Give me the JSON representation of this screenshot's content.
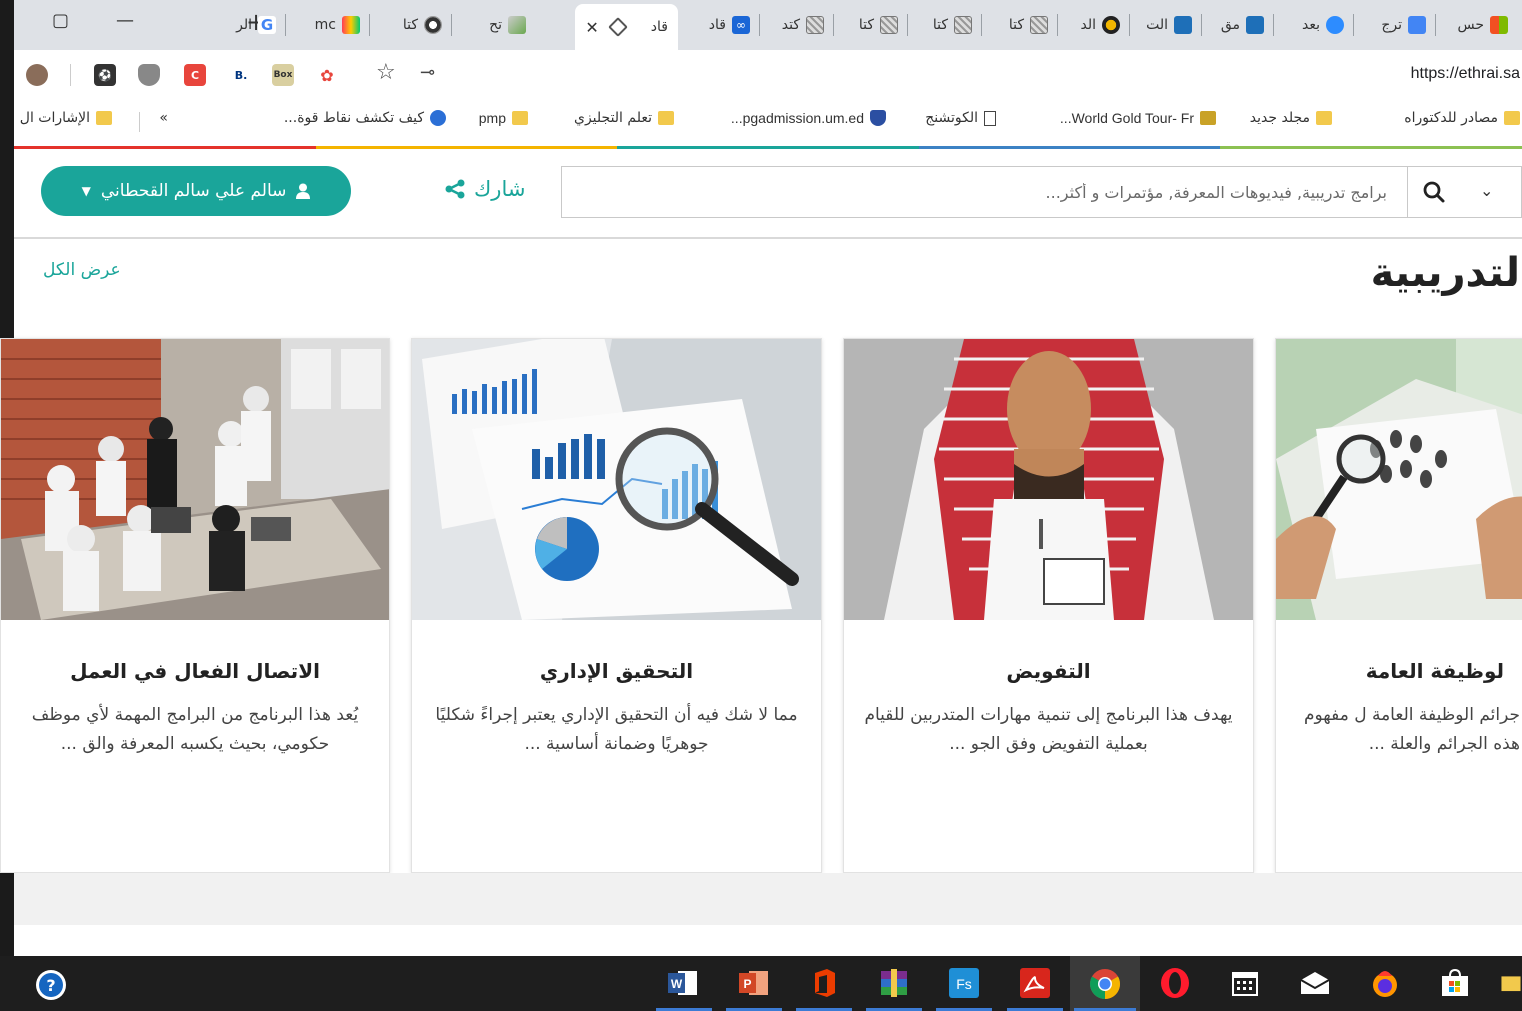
{
  "browser": {
    "tabs": [
      {
        "label": "حس",
        "icon": "microsoft-icon"
      },
      {
        "label": "ترج",
        "icon": "google-translate-icon"
      },
      {
        "label": "بعد",
        "icon": "zoom-icon"
      },
      {
        "label": "مق",
        "icon": "doc-icon"
      },
      {
        "label": "الت",
        "icon": "doc-icon"
      },
      {
        "label": "الد",
        "icon": "circle-icon"
      },
      {
        "label": "كتا",
        "icon": "qr-icon"
      },
      {
        "label": "كتا",
        "icon": "qr-icon"
      },
      {
        "label": "كتا",
        "icon": "qr-icon"
      },
      {
        "label": "كتد",
        "icon": "qr-icon"
      },
      {
        "label": "قاد",
        "icon": "infinity-icon"
      },
      {
        "label": "قاد",
        "icon": "diamond-icon",
        "active": true
      },
      {
        "label": "تح",
        "icon": "map-icon"
      },
      {
        "label": "كتا",
        "icon": "ring-icon"
      },
      {
        "label": "mc",
        "icon": "monday-icon"
      },
      {
        "label": "الر",
        "icon": "google-icon"
      }
    ],
    "url": "https://ethrai.sa",
    "bookmarks": [
      {
        "label": "مصادر للدكتوراه",
        "icon": "folder-icon"
      },
      {
        "label": "مجلد جديد",
        "icon": "folder-icon"
      },
      {
        "label": "World Gold Tour- Fr...",
        "icon": "gold-icon"
      },
      {
        "label": "الكوتشنج",
        "icon": "page-icon"
      },
      {
        "label": "pgadmission.um.ed...",
        "icon": "shield-icon"
      },
      {
        "label": "تعلم التجليزي",
        "icon": "folder-icon"
      },
      {
        "label": "pmp",
        "icon": "folder-icon"
      },
      {
        "label": "كيف تكشف نقاط قوة...",
        "icon": "blue-circle-icon"
      },
      {
        "label": "»",
        "icon": ""
      },
      {
        "label": "الإشارات ال",
        "icon": "folder-icon"
      }
    ]
  },
  "header": {
    "user_name": "سالم علي سالم القحطاني",
    "share_label": "شارك",
    "search_placeholder": "برامج تدريبية, فيديوهات المعرفة, مؤتمرات و أكثر..."
  },
  "section": {
    "title": "لتدريبية",
    "view_all": "عرض الكل"
  },
  "cards": [
    {
      "title": "الاتصال الفعال في العمل",
      "desc": "يُعد هذا البرنامج من البرامج المهمة لأي موظف حكومي، بحيث يكسبه المعرفة والق ..."
    },
    {
      "title": "التحقيق الإداري",
      "desc": "مما لا شك فيه أن التحقيق الإداري يعتبر إجراءً شكليًا جوهريًا وضمانة أساسية ..."
    },
    {
      "title": "التفويض",
      "desc": "يهدف هذا البرنامج إلى تنمية مهارات المتدربين للقيام بعملية التفويض وفق الجو ..."
    },
    {
      "title": "لوظيفة العامة",
      "desc": "جرائم الوظيفة العامة ل مفهوم هذه الجرائم والعلة ..."
    }
  ],
  "colors": {
    "accent": "#1aa59a",
    "taskbar": "#1e1e1e",
    "tabstrip": "#dee1e6"
  }
}
